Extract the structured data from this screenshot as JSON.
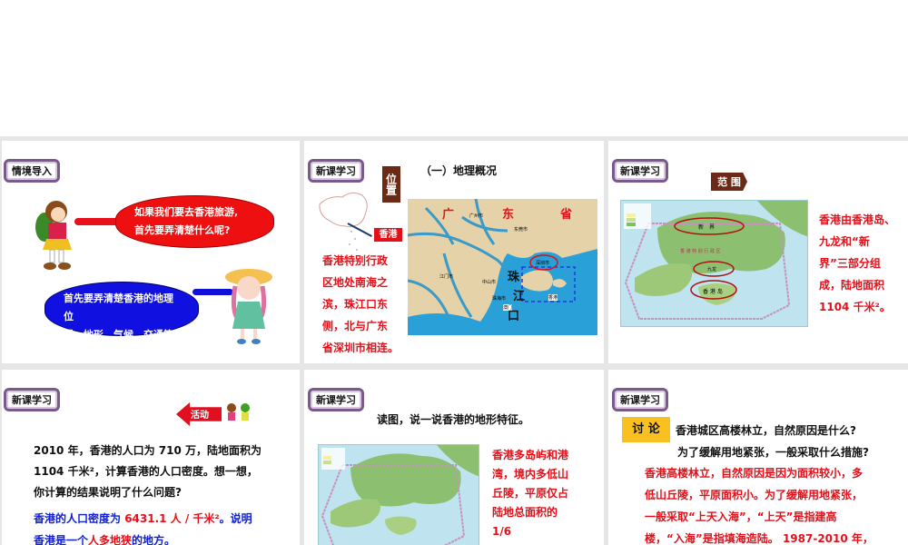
{
  "slides": [
    {
      "tag": "情境导入",
      "bubble1": [
        "如果我们要去香港旅游,",
        "首先要弄清楚什么呢?"
      ],
      "bubble2": [
        "首先要弄清楚香港的地理位",
        "置、地形、气候、交通等"
      ]
    },
    {
      "tag": "新课学习",
      "label": "位置",
      "title": "（一）地理概况",
      "hk_label": "香港",
      "text": [
        "香港特别行政",
        "区地处南海之",
        "滨，珠江口东",
        "侧，北与广东",
        "省深圳市相连。"
      ],
      "map": {
        "province": [
          "广",
          "东",
          "省"
        ],
        "cities": [
          "广州市",
          "东莞市",
          "江门市",
          "中山市",
          "珠海市",
          "澳门",
          "深圳市",
          "香港"
        ],
        "river": [
          "珠",
          "江",
          "口"
        ]
      }
    },
    {
      "tag": "新课学习",
      "label": "范 围",
      "text": [
        "香港由香港岛、",
        "九龙和“新",
        "界”三部分组",
        "成，陆地面积",
        "1104 千米²。"
      ],
      "map": {
        "labels": [
          "新　界",
          "九龙",
          "香 港 岛",
          "香 港 特 别 行 政 区"
        ]
      }
    },
    {
      "tag": "新课学习",
      "activity": "活动",
      "question": [
        "2010 年，香港的人口为 710 万，陆地面积为",
        "1104 千米²，计算香港的人口密度。想一想，",
        "你计算的结果说明了什么问题?"
      ],
      "answer": {
        "a1": "香港的人口密度为 ",
        "a2": "6431.1 人 / 千米²",
        "a3": "。说明",
        "b1": "香港是一个",
        "b2": "人多地狭",
        "b3": "的地方。"
      }
    },
    {
      "tag": "新课学习",
      "title": "读图，说一说香港的地形特征。",
      "text": [
        "香港多岛屿和港",
        "湾，境内多低山",
        "丘陵，平原仅占",
        "陆地总面积的",
        "1/6"
      ]
    },
    {
      "tag": "新课学习",
      "label": "讨 论",
      "question": [
        "香港城区高楼林立，自然原因是什么?",
        "为了缓解用地紧张，一般采取什么措施?"
      ],
      "answer": [
        "香港高楼林立，自然原因是因为面积较小，多",
        "低山丘陵，平原面积小。为了缓解用地紧张，",
        "一般采取“上天入海”，“上天”是指建高",
        "楼，“入海”是指填海造陆。 1987-2010 年，"
      ]
    }
  ]
}
